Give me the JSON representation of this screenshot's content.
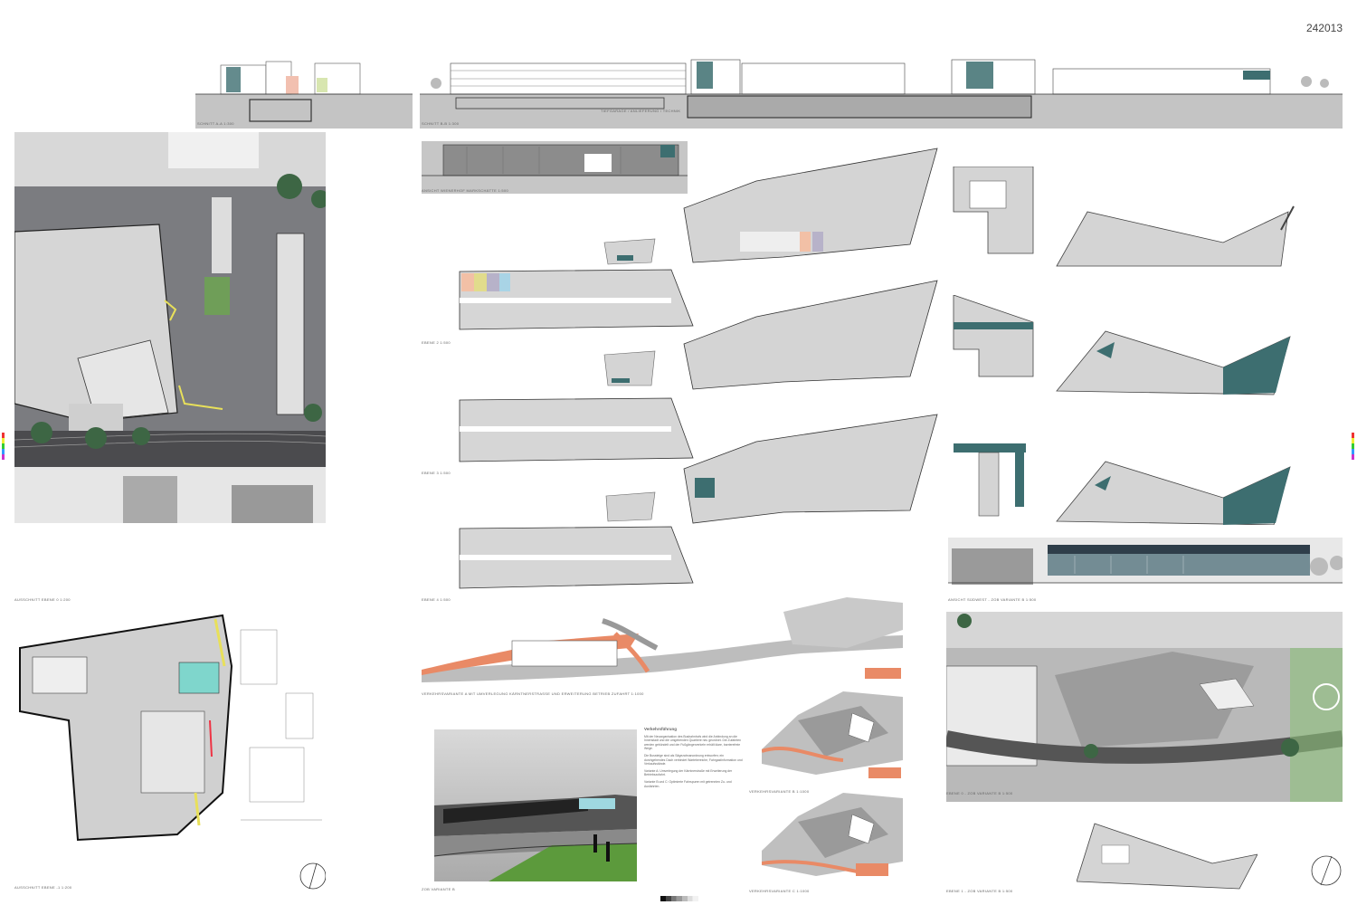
{
  "sheet_id": "242013",
  "captions": {
    "section_aa": "SCHNITT A-A  1:300",
    "section_bb": "SCHNITT B-B  1:300",
    "section_note": "TIEFGARAGE / ANLIEFERUNG / TECHNIK",
    "elevation_market": "ANSICHT WIENERHOF MARKSCHÄTTE  1:500",
    "detail_level0": "AUSSCHNITT EBENE 0  1:200",
    "detail_level_minus1": "AUSSCHNITT EBENE -1  1:200",
    "level2": "EBENE 2  1:500",
    "level3": "EBENE 3  1:500",
    "level4": "EBENE 4  1:500",
    "traffic_a": "VERKEHRSVARIANTE A MIT UMVERLEGUNG KÄRNTNERSTRASSE UND ERWEITERUNG BETRIEB ZUFAHRT  1:1000",
    "traffic_b": "VERKEHRSVARIANTE B  1:1000",
    "traffic_c": "VERKEHRSVARIANTE C  1:1000",
    "zob_b": "ZOB VARIANTE B",
    "elevation_bus": "ANSICHT SÜDWEST - ZOB VARIANTE B  1:500",
    "level0_zob": "EBENE 0 - ZOB VARIANTE B  1:500",
    "level1_zob": "EBENE 1 - ZOB VARIANTE B  1:500"
  },
  "text_block": {
    "heading": "Verkehrsführung",
    "paragraphs": [
      "Mit der Neuorganisation des Busbahnhofs wird die Anbindung an die Innenstadt und die umgebenden Quartiere neu geordnet. Die Zufahrten werden gebündelt und der Fußgängerverkehr erhält klare, barrierefreie Wege.",
      "Die Bussteige sind als Sägezahnanordnung entworfen; ein durchgehendes Dach verbindet Wartebereiche, Fahrgastinformation und Verkaufsstände.",
      "Variante A: Umverlegung der Kärntnerstraße mit Erweiterung der Betriebszufahrt.",
      "Variante B und C: Optimierte Fahrspuren mit getrennten Zu- und Ausfahrten."
    ]
  },
  "colors": {
    "accent_teal": "#3d6e70",
    "traffic_orange": "#e98a66",
    "highlight_yellow": "#e8e05a",
    "aqua": "#7fd6cc",
    "grass": "#5c9a3c"
  }
}
